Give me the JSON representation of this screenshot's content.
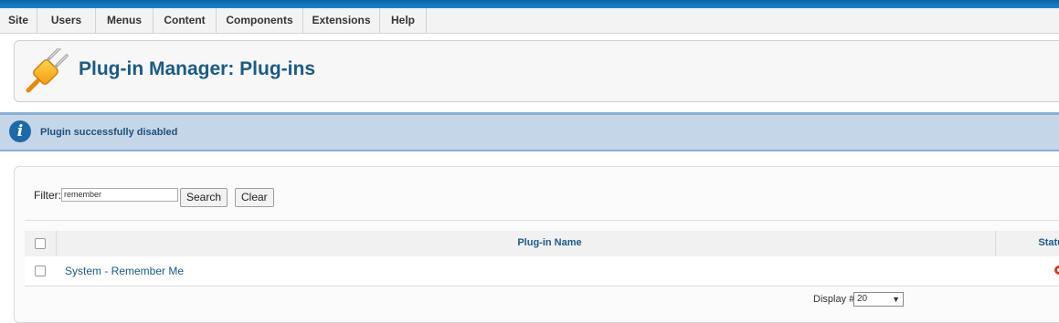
{
  "menu": {
    "items": [
      {
        "label": "Site"
      },
      {
        "label": "Users"
      },
      {
        "label": "Menus"
      },
      {
        "label": "Content"
      },
      {
        "label": "Components"
      },
      {
        "label": "Extensions"
      },
      {
        "label": "Help"
      }
    ]
  },
  "header": {
    "title": "Plug-in Manager: Plug-ins",
    "icon": "plugin-icon"
  },
  "message": {
    "text": "Plugin successfully disabled",
    "icon": "info-icon"
  },
  "filter": {
    "label": "Filter:",
    "value": "remember",
    "search_label": "Search",
    "clear_label": "Clear"
  },
  "table": {
    "columns": {
      "name": "Plug-in Name",
      "status": "Status"
    },
    "rows": [
      {
        "name": "System - Remember Me",
        "status": "disabled"
      }
    ]
  },
  "pagination": {
    "display_label": "Display #",
    "display_value": "20"
  },
  "colors": {
    "accent": "#1b5b86",
    "message_bg": "#c6d6e9",
    "status_disabled": "#c8411c"
  }
}
